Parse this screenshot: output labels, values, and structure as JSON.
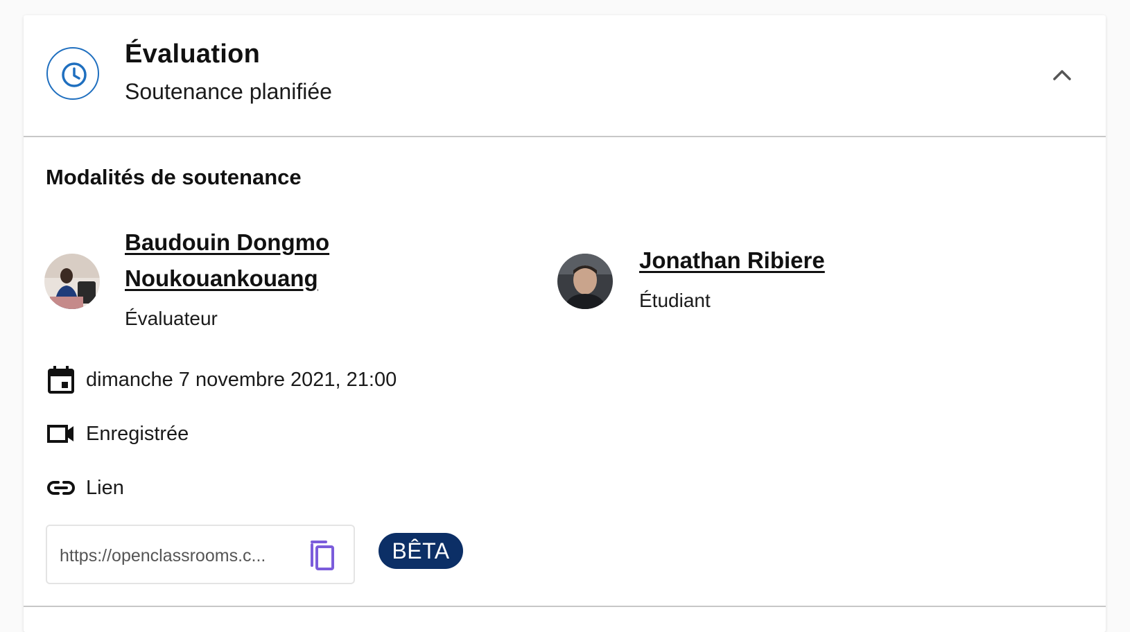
{
  "header": {
    "title": "Évaluation",
    "subtitle": "Soutenance planifiée",
    "status_icon": "clock-icon",
    "collapse_icon": "chevron-up-icon",
    "accent_color": "#1f6fbf"
  },
  "section": {
    "title": "Modalités de soutenance"
  },
  "participants": [
    {
      "name_line1": "Baudouin Dongmo",
      "name_line2": "Noukouankouang",
      "role": "Évaluateur"
    },
    {
      "name": "Jonathan Ribiere",
      "role": "Étudiant"
    }
  ],
  "details": {
    "date": "dimanche 7 novembre 2021, 21:00",
    "recording": "Enregistrée",
    "link_label": "Lien",
    "link_value": "https://openclassrooms.c...",
    "beta_badge": "BÊTA",
    "badge_color": "#0c2f66",
    "copy_icon_color": "#7b5cdb"
  }
}
